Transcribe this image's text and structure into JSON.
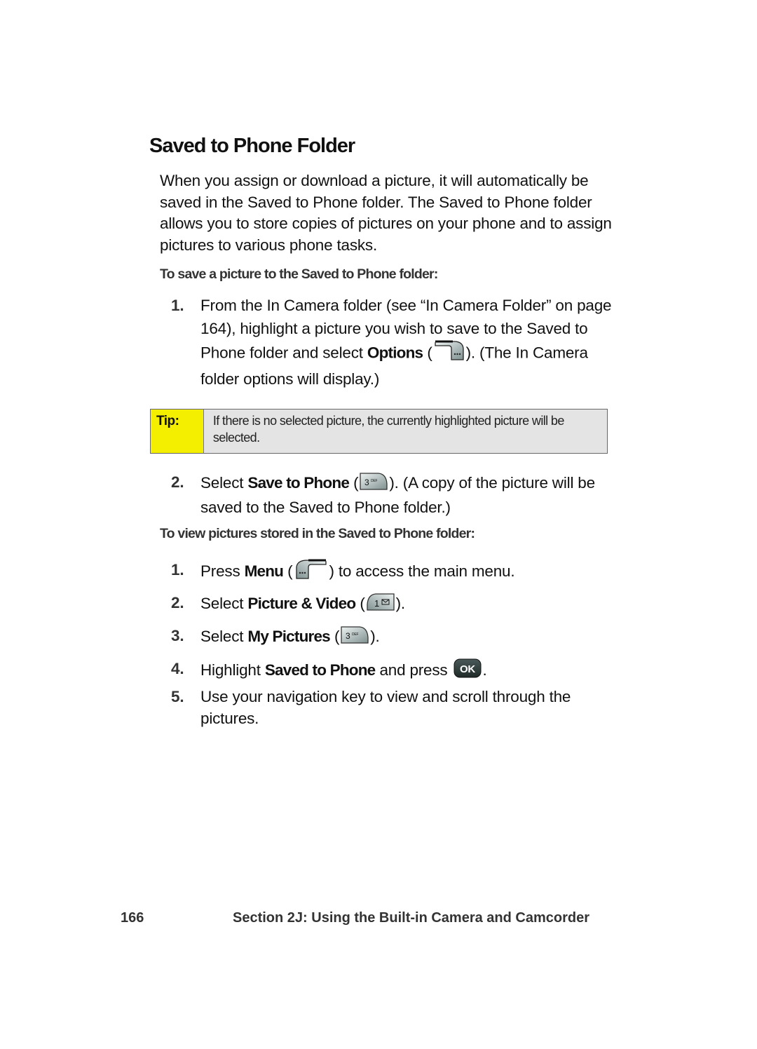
{
  "heading": "Saved to Phone Folder",
  "intro": "When you assign or download a picture, it will automatically be saved in the Saved to Phone folder. The Saved to Phone folder allows you to store copies of pictures on your phone and to assign pictures to various phone tasks.",
  "save_section": {
    "subheading": "To save a picture to the Saved to Phone folder:",
    "step1": {
      "num": "1.",
      "pre": "From the In Camera folder (see “In Camera Folder” on page 164), highlight a picture you wish to save to the Saved to Phone folder and select ",
      "bold": "Options",
      "open": " (",
      "post": "). (The In Camera folder options will display.)",
      "key_icon": "right-softkey-icon"
    },
    "tip": {
      "label": "Tip:",
      "text": "If there is no selected picture, the currently highlighted picture will be selected.",
      "color": "#f4ee00"
    },
    "step2": {
      "num": "2.",
      "pre": "Select ",
      "bold": "Save to Phone",
      "open": " (",
      "post": "). (A copy of the picture will be saved to the Saved to Phone folder.)",
      "key_icon": "key-3-def-icon",
      "key_digit": "3",
      "key_letters": "DEF"
    }
  },
  "view_section": {
    "subheading": "To view pictures stored in the Saved to Phone folder:",
    "steps": [
      {
        "num": "1.",
        "pre": "Press ",
        "bold": "Menu",
        "open": " (",
        "post": ") to access the main menu.",
        "key_icon": "left-softkey-icon"
      },
      {
        "num": "2.",
        "pre": "Select ",
        "bold": "Picture & Video",
        "open": " (",
        "post": ").",
        "key_icon": "key-1-voicemail-icon",
        "key_digit": "1"
      },
      {
        "num": "3.",
        "pre": "Select ",
        "bold": "My Pictures",
        "open": " (",
        "post": ").",
        "key_icon": "key-3-def-icon",
        "key_digit": "3",
        "key_letters": "DEF"
      },
      {
        "num": "4.",
        "pre": "Highlight ",
        "bold": "Saved to Phone",
        "open": " and press ",
        "post": ".",
        "key_icon": "ok-key-icon",
        "key_label": "OK"
      },
      {
        "num": "5.",
        "pre": "Use your navigation key to view and scroll through the pictures.",
        "bold": "",
        "open": "",
        "post": ""
      }
    ]
  },
  "footer": {
    "page_number": "166",
    "section": "Section 2J: Using the Built-in Camera and Camcorder"
  }
}
